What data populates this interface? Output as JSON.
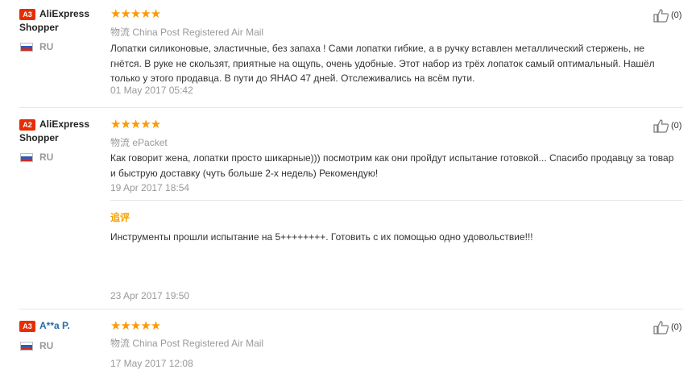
{
  "reviews": [
    {
      "badge": "A3",
      "user_line1": "AliExpress",
      "user_line2": "Shopper",
      "country": "RU",
      "stars": "★★★★★",
      "shipping_label": "物流",
      "shipping": "China Post Registered Air Mail",
      "content": "Лопатки силиконовые, эластичные, без запаха ! Сами лопатки гибкие, а в ручку вставлен металлический стержень, не гнётся. В руке не скользят, приятные на ощупь, очень удобные. Этот набор из трёх лопаток самый оптимальный. Нашёл только у этого продавца. В пути до ЯНАО 47 дней. Отслеживались на всём пути.",
      "date": "01 May 2017 05:42",
      "likes": "(0)"
    },
    {
      "badge": "A2",
      "user_line1": "AliExpress",
      "user_line2": "Shopper",
      "country": "RU",
      "stars": "★★★★★",
      "shipping_label": "物流",
      "shipping": "ePacket",
      "content": "Как говорит жена, лопатки просто шикарные))) посмотрим как они пройдут испытание готовкой... Спасибо продавцу за товар и быструю доставку (чуть больше 2-х недель) Рекомендую!",
      "date": "19 Apr 2017 18:54",
      "additional_label": "追评",
      "additional_content": "Инструменты прошли испытание на 5++++++++. Готовить с их помощью одно удовольствие!!!",
      "additional_date": "23 Apr 2017 19:50",
      "likes": "(0)"
    },
    {
      "badge": "A3",
      "user_line1": "A**a P.",
      "country": "RU",
      "stars": "★★★★★",
      "shipping_label": "物流",
      "shipping": "China Post Registered Air Mail",
      "date": "17 May 2017 12:08",
      "likes": "(0)"
    }
  ],
  "colors": {
    "star": "#ff9900",
    "badge": "#e62e04",
    "link": "#2b6aa8"
  },
  "icons": {
    "like": "thumbs-up-icon",
    "flag": "russia-flag-icon"
  }
}
